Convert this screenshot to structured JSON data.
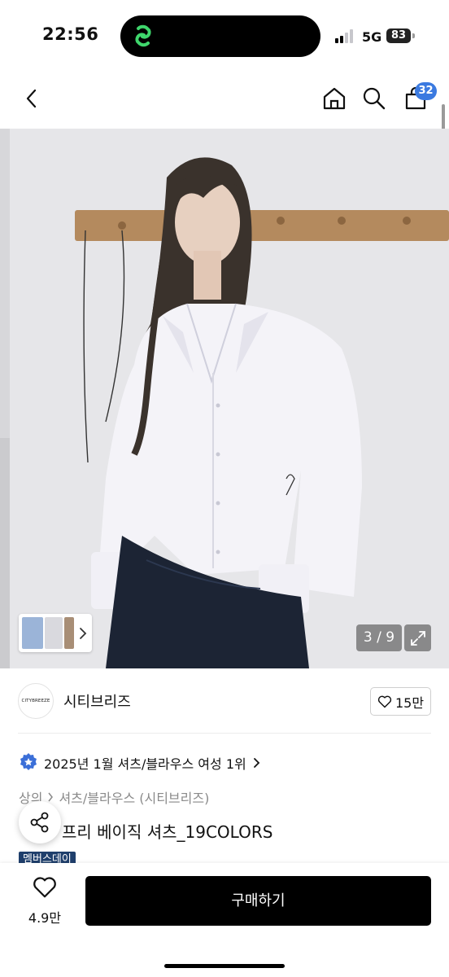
{
  "status": {
    "time": "22:56",
    "network": "5G",
    "battery": "83"
  },
  "nav": {
    "cart_count": "32"
  },
  "gallery": {
    "counter": "3 / 9"
  },
  "brand": {
    "logo_text": "CITYBREEZE",
    "name": "시티브리즈",
    "likes": "15만"
  },
  "ranking": {
    "text": "2025년 1월 셔츠/블라우스 여성 1위"
  },
  "breadcrumb": {
    "category": "상의",
    "subcategory": "셔츠/블라우스 (시티브리즈)"
  },
  "product": {
    "title": "프리 베이직 셔츠_19COLORS",
    "badge": "멤버스데이"
  },
  "bottom": {
    "like_count": "4.9만",
    "buy_label": "구매하기"
  },
  "colors": {
    "badge": "#3b7ae0",
    "buy_button": "#000000",
    "member_badge": "#1f3f6c"
  }
}
